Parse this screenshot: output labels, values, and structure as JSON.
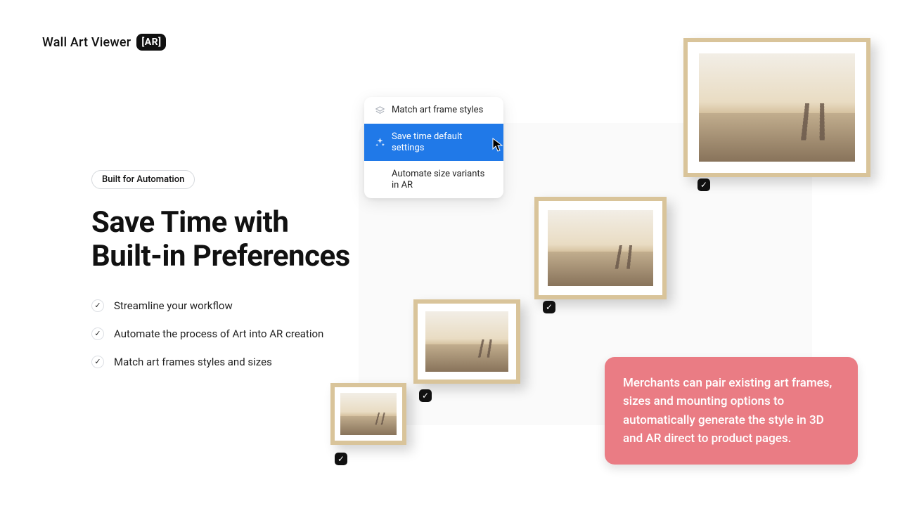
{
  "logo": {
    "text": "Wall Art Viewer",
    "badge": "[AR]"
  },
  "pill": "Built for Automation",
  "headline_line1": "Save Time with",
  "headline_line2": "Built-in Preferences",
  "bullets": [
    "Streamline your workflow",
    "Automate the process of Art into AR creation",
    "Match art frames styles and sizes"
  ],
  "menu": {
    "items": [
      {
        "label": "Match art frame styles",
        "selected": false
      },
      {
        "label": "Save time default settings",
        "selected": true
      },
      {
        "label": "Automate size variants in AR",
        "selected": false
      }
    ]
  },
  "callout": "Merchants can pair existing art frames, sizes and mounting options to automatically generate the style in 3D and AR direct to product pages.",
  "colors": {
    "accent": "#2079e8",
    "callout": "#ea7c84",
    "frame": "#d9c49a"
  }
}
